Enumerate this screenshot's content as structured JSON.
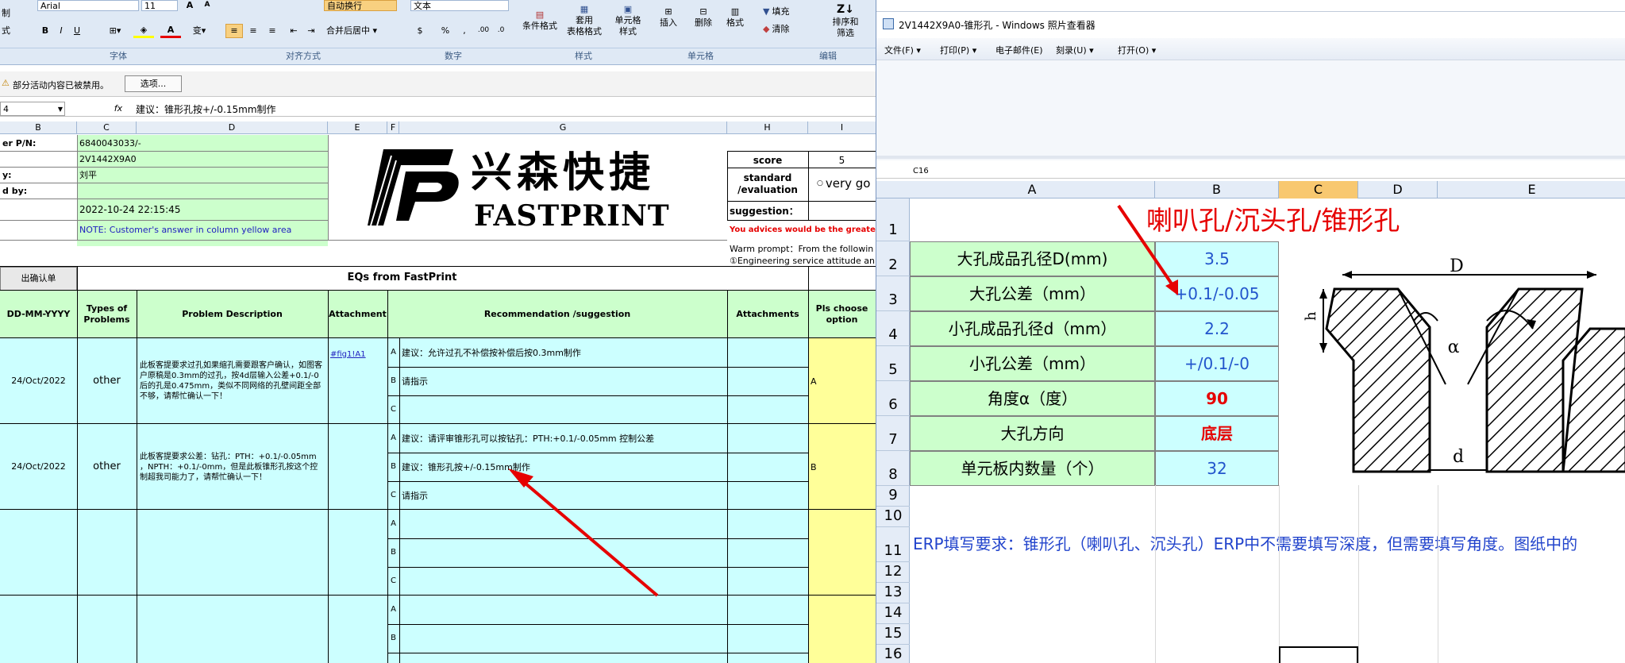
{
  "colors": {
    "ribbon": "#dfe9f5",
    "green": "#ccffcc",
    "cyan": "#ccffff",
    "yellow": "#ffff99",
    "red": "#e60000",
    "blue_text": "#2255cc"
  },
  "excel": {
    "ribbon": {
      "left_labels": [
        "制",
        "式"
      ],
      "font_name": "Arial",
      "font_size": "11",
      "autowrap": "自动换行",
      "merge_center": "合并后居中 ▾",
      "number_format": "文本",
      "cond_format": "条件格式",
      "table_format_1": "套用",
      "table_format_2": "表格格式",
      "cell_style_1": "单元格",
      "cell_style_2": "样式",
      "insert": "插入",
      "delete": "删除",
      "format": "格式",
      "fill": "填充",
      "clear": "清除",
      "sort_1": "排序和",
      "sort_2": "筛选",
      "groups": [
        "字体",
        "对齐方式",
        "数字",
        "样式",
        "单元格",
        "编辑"
      ]
    },
    "security_bar": {
      "message": "部分活动内容已被禁用。",
      "button": "选项..."
    },
    "formula_bar": {
      "namebox": "4",
      "fx": "fx",
      "content": "建议：锥形孔按+/-0.15mm制作"
    },
    "columns": [
      "B",
      "C",
      "D",
      "E",
      "F",
      "G",
      "H",
      "I"
    ],
    "header_left": {
      "labels": [
        "er P/N:",
        "",
        "y:",
        "d by:",
        "",
        ""
      ],
      "values": [
        "6840043033/-",
        "2V1442X9A0",
        "刘平",
        "",
        "2022-10-24 22:15:45",
        "NOTE: Customer's  answer in column yellow area"
      ]
    },
    "logo": {
      "cn": "兴森快捷",
      "en": "FASTPRINT"
    },
    "right_block": {
      "score_label": "score",
      "score_value": "5",
      "standard_label": "standard\n/evaluation",
      "radio_text": "very go",
      "suggestion_label": "suggestion：",
      "advice": "You advices would be the greates",
      "warm_1": "Warm prompt：From the followin",
      "warm_2": "①Engineering service attitude an"
    },
    "eq_title": "EQs from FastPrint",
    "confirm_tab": "出确认单",
    "table_headers": {
      "date": "DD-MM-YYYY",
      "type": "Types of Problems",
      "desc": "Problem Description",
      "attach": "Attachment",
      "rec": "Recommendation /suggestion",
      "attachments": "Attachments",
      "choose": "Pls choose option"
    },
    "rows": [
      {
        "date": "24/Oct/2022",
        "type": "other",
        "desc": "此板客提要求过孔如果缩孔需要跟客户确认，如图客户原稿是0.3mm的过孔，按4d层输入公差+0.1/-0后的孔是0.475mm，类似不同网络的孔壁间距全部不够，请帮忙确认一下！",
        "attach": "#fig1!A1",
        "options": [
          {
            "letter": "A",
            "text": "建议：允许过孔不补偿按补偿后按0.3mm制作"
          },
          {
            "letter": "B",
            "text": "请指示"
          },
          {
            "letter": "C",
            "text": ""
          }
        ],
        "choice": "A"
      },
      {
        "date": "24/Oct/2022",
        "type": "other",
        "desc": "此板客提要求公差：钻孔：PTH：+0.1/-0.05mm ，NPTH：+0.1/-0mm，但是此板锥形孔按这个控制超我司能力了，请帮忙确认一下！",
        "attach": "",
        "options": [
          {
            "letter": "A",
            "text": "建议：请评审锥形孔可以按钻孔：PTH:+0.1/-0.05mm 控制公差"
          },
          {
            "letter": "B",
            "text": "建议：锥形孔按+/-0.15mm制作"
          },
          {
            "letter": "C",
            "text": "请指示"
          }
        ],
        "choice": "B"
      },
      {
        "date": "",
        "type": "",
        "desc": "",
        "attach": "",
        "options": [
          {
            "letter": "A",
            "text": ""
          },
          {
            "letter": "B",
            "text": ""
          },
          {
            "letter": "C",
            "text": ""
          }
        ],
        "choice": ""
      },
      {
        "date": "",
        "type": "",
        "desc": "",
        "attach": "",
        "options": [
          {
            "letter": "A",
            "text": ""
          },
          {
            "letter": "B",
            "text": ""
          },
          {
            "letter": "C",
            "text": ""
          }
        ],
        "choice": ""
      }
    ]
  },
  "viewer": {
    "title": "2V1442X9A0-锥形孔 - Windows 照片查看器",
    "menu": [
      "文件(F) ▾",
      "打印(P) ▾",
      "电子邮件(E)",
      "刻录(U) ▾",
      "打开(O) ▾"
    ],
    "namebox": "C16",
    "columns": [
      "A",
      "B",
      "C",
      "D",
      "E"
    ],
    "row_numbers": [
      "1",
      "2",
      "3",
      "4",
      "5",
      "6",
      "7",
      "8",
      "9",
      "10",
      "11",
      "12",
      "13",
      "14",
      "15",
      "16"
    ],
    "title_cell": "喇叭孔/沉头孔/锥形孔",
    "params": [
      {
        "label": "大孔成品孔径D(mm)",
        "value": "3.5",
        "red": false
      },
      {
        "label": "大孔公差（mm）",
        "value": "+0.1/-0.05",
        "red": false
      },
      {
        "label": "小孔成品孔径d（mm）",
        "value": "2.2",
        "red": false
      },
      {
        "label": "小孔公差（mm）",
        "value": "+/0.1/-0",
        "red": false
      },
      {
        "label": "角度α（度）",
        "value": "90",
        "red": true
      },
      {
        "label": "大孔方向",
        "value": "底层",
        "red": true
      },
      {
        "label": "单元板内数量（个）",
        "value": "32",
        "red": false
      }
    ],
    "diagram_labels": {
      "D": "D",
      "h": "h",
      "alpha": "α",
      "d": "d"
    },
    "erp_note": "ERP填写要求：锥形孔（喇叭孔、沉头孔）ERP中不需要填写深度，但需要填写角度。图纸中的"
  }
}
